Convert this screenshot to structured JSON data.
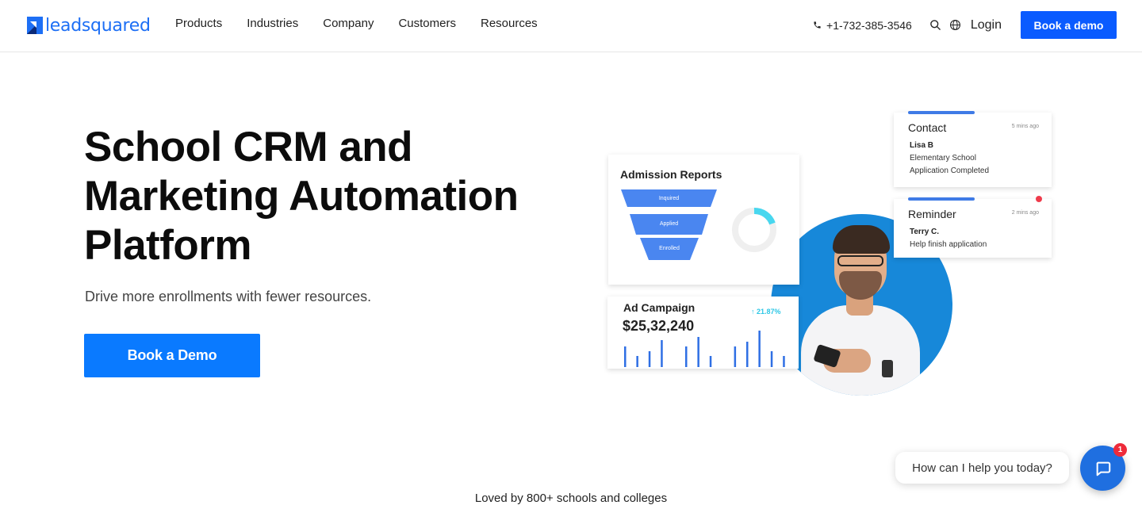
{
  "nav": {
    "logo_text": "leadsquared",
    "links": [
      "Products",
      "Industries",
      "Company",
      "Customers",
      "Resources"
    ],
    "phone": "+1-732-385-3546",
    "login": "Login",
    "cta": "Book a demo",
    "icons": [
      "phone-icon",
      "search-icon",
      "globe-icon"
    ]
  },
  "hero": {
    "title": "School CRM and Marketing Automation Platform",
    "subtitle": "Drive more enrollments with fewer resources.",
    "cta": "Book a Demo"
  },
  "illustration": {
    "admission": {
      "title": "Admission Reports",
      "stages": [
        "Inquired",
        "Applied",
        "Enrolled"
      ]
    },
    "ad_campaign": {
      "title": "Ad Campaign",
      "value": "$25,32,240",
      "change": "↑ 21.87%",
      "bars": [
        26,
        14,
        20,
        34,
        2,
        26,
        38,
        14,
        2,
        26,
        32,
        46,
        20,
        14
      ]
    },
    "contact": {
      "title": "Contact",
      "time": "5 mins ago",
      "name": "Lisa B",
      "lines": [
        "Elementary School",
        "Application Completed"
      ]
    },
    "reminder": {
      "title": "Reminder",
      "time": "2 mins ago",
      "name": "Terry C.",
      "line": "Help finish application"
    }
  },
  "social_proof": "Loved by 800+ schools and colleges",
  "chat": {
    "prompt": "How can I help you today?",
    "badge": "1"
  },
  "colors": {
    "brand_blue": "#0a5bff",
    "hero_button": "#0a7aff",
    "funnel": "#4a86f0",
    "accent_cyan": "#2ec7e6",
    "alert_red": "#ee2b3a"
  }
}
